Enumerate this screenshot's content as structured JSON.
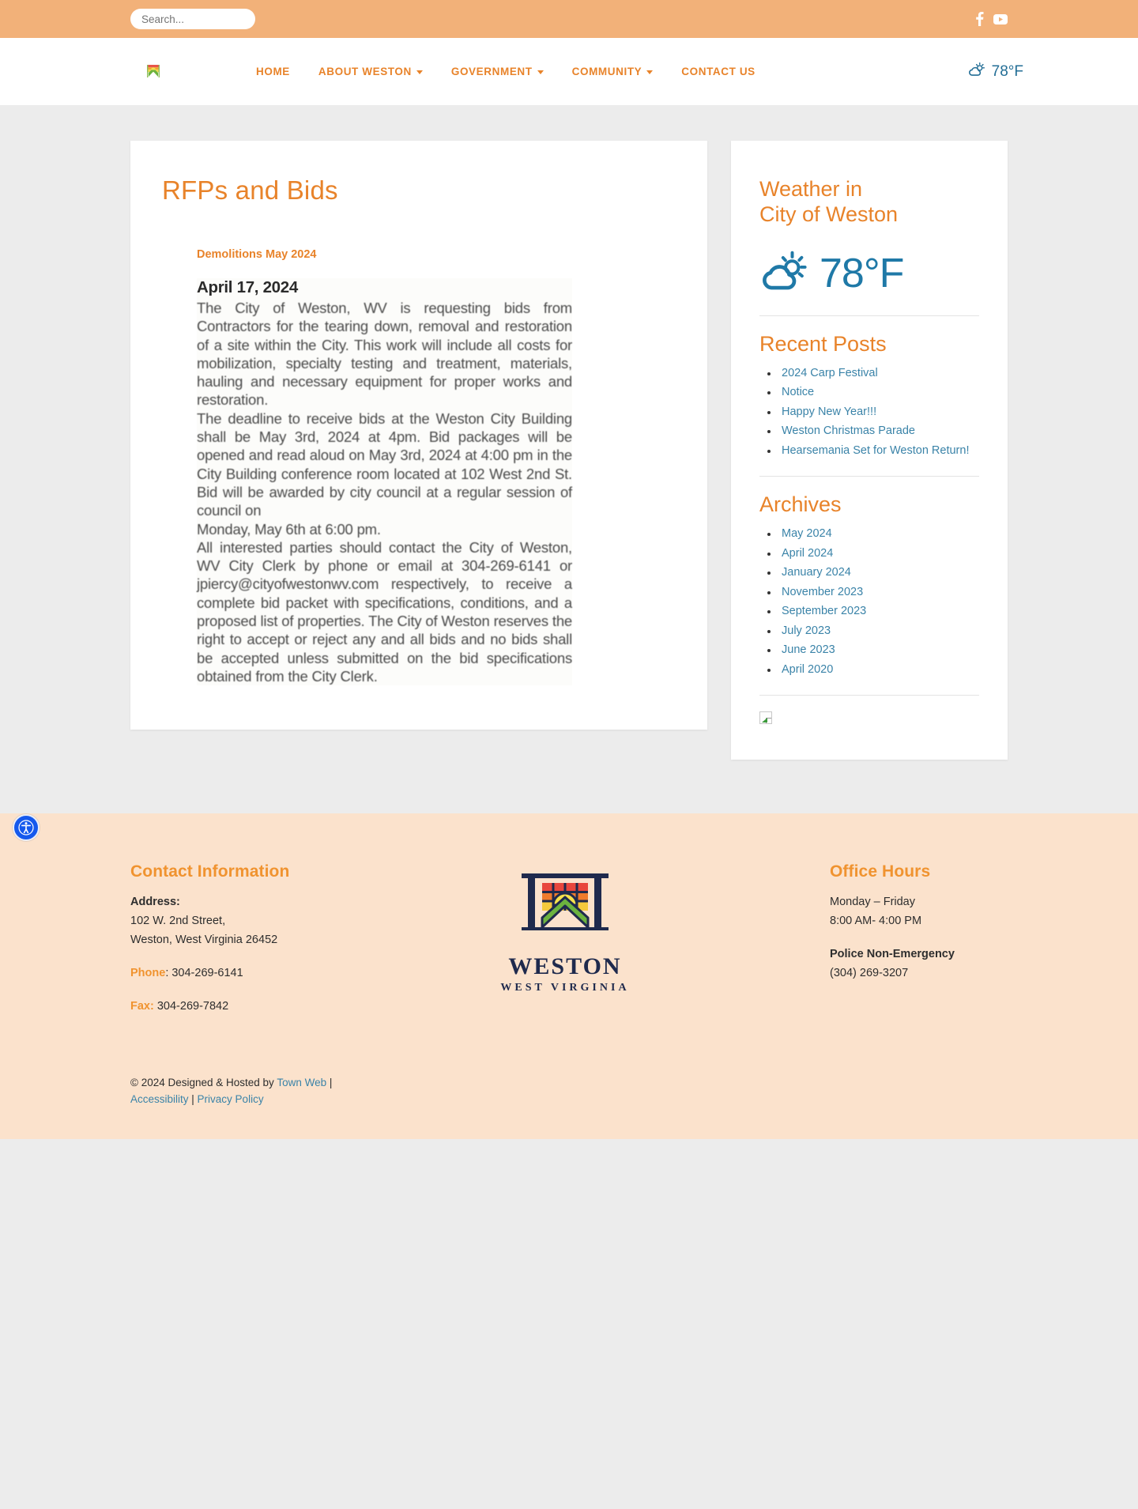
{
  "topbar": {
    "search_placeholder": "Search...",
    "search_value": "",
    "social": [
      {
        "name": "facebook-icon",
        "label": "Facebook"
      },
      {
        "name": "youtube-icon",
        "label": "YouTube"
      }
    ]
  },
  "header": {
    "logo_alt": "City of Weston logo",
    "nav": [
      {
        "label": "HOME",
        "has_dropdown": false
      },
      {
        "label": "ABOUT WESTON",
        "has_dropdown": true
      },
      {
        "label": "GOVERNMENT",
        "has_dropdown": true
      },
      {
        "label": "COMMUNITY",
        "has_dropdown": true
      },
      {
        "label": "CONTACT US",
        "has_dropdown": false
      }
    ],
    "weather_temp": "78°F"
  },
  "main": {
    "page_title": "RFPs and Bids",
    "doc_heading": "Demolitions May 2024",
    "scan": {
      "date": "April 17, 2024",
      "para1": "The City of Weston, WV is requesting bids from Contractors for the tearing down, removal and restoration of a site within the City. This work will include all costs for mobilization, specialty testing and treatment, materials, hauling and necessary equipment for proper works and restoration.",
      "para2": "The deadline to receive bids at the Weston City Building shall be May 3rd, 2024 at 4pm. Bid packages will be opened and read aloud on May 3rd, 2024 at 4:00 pm in the City Building conference room located at 102 West 2nd St. Bid will be awarded by city council at a regular session of council on",
      "para3": "Monday, May 6th at 6:00 pm.",
      "para4": "All interested parties should contact the City of Weston, WV City Clerk by phone or email at 304-269-6141 or jpiercy@cityofwestonwv.com respectively, to receive a complete bid packet with specifications, conditions, and a proposed list of properties. The City of Weston reserves the right to accept or reject any and all bids and no bids shall be accepted unless submitted on the bid specifications obtained from the City Clerk."
    }
  },
  "sidebar": {
    "weather_title": "Weather in City of Weston",
    "weather_title_line1": "Weather in",
    "weather_title_line2": "City of Weston",
    "weather_temp": "78°F",
    "recent_posts_title": "Recent Posts",
    "recent_posts": [
      "2024 Carp Festival",
      "Notice",
      "Happy New Year!!!",
      "Weston Christmas Parade",
      "Hearsemania Set for Weston Return!"
    ],
    "archives_title": "Archives",
    "archives": [
      "May 2024",
      "April 2024",
      "January 2024",
      "November 2023",
      "September 2023",
      "July 2023",
      "June 2023",
      "April 2020"
    ]
  },
  "footer": {
    "contact_title": "Contact Information",
    "address_label": "Address:",
    "address_line1": "102 W. 2nd Street,",
    "address_line2": "Weston, West Virginia 26452",
    "phone_label": "Phone",
    "phone_value": ": 304-269-6141",
    "fax_label": "Fax:",
    "fax_value": " 304-269-7842",
    "logo_word": "WESTON",
    "logo_sub": "WEST VIRGINIA",
    "hours_title": "Office Hours",
    "hours_line1": "Monday – Friday",
    "hours_line2": "8:00 AM- 4:00 PM",
    "police_label": "Police Non-Emergency",
    "police_value": "(304) 269-3207",
    "copyright_prefix": "© 2024 Designed & Hosted by ",
    "copyright_link": "Town Web",
    "copyright_sep": " |",
    "accessibility_link": "Accessibility",
    "privacy_sep": " | ",
    "privacy_link": "Privacy Policy"
  },
  "accessibility_widget": {
    "name": "accessibility-icon"
  },
  "colors": {
    "accent_orange": "#e8832a",
    "topbar_peach": "#f2b179",
    "footer_peach": "#fbe2cc",
    "link_blue": "#3a83a8",
    "weather_blue": "#1f79a7",
    "logo_navy": "#1f2a4d",
    "a11y_blue": "#1559ed"
  }
}
